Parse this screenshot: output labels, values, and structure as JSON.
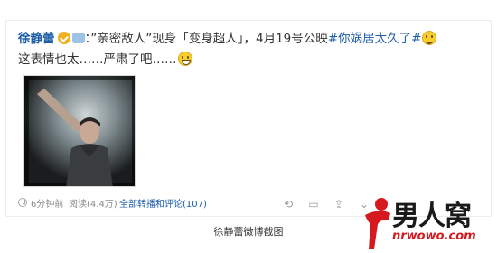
{
  "post": {
    "username": "徐静蕾",
    "text_colon": "：",
    "text_1": "”亲密敌人”现身「变身超人」，4月19号公映",
    "topic": "#你娲居太久了#",
    "text_2": "这表情也太……严肃了吧……",
    "smiley_icon": "smile-emoticon",
    "grin_icon": "grin-emoticon"
  },
  "meta": {
    "time": "6分钟前",
    "reads": "阅读(4.4万)",
    "reposts_label": "全部转播和评论(107)",
    "tools": [
      "repost-icon",
      "comment-icon",
      "share-icon",
      "more-icon"
    ]
  },
  "caption": "徐静蕾微博截图",
  "watermark": {
    "title": "男人窝",
    "url": "nrwowo.com"
  },
  "colors": {
    "link": "#1e5ea8",
    "text": "#333333",
    "muted": "#8a8a8a",
    "brand_red": "#d6191f"
  }
}
